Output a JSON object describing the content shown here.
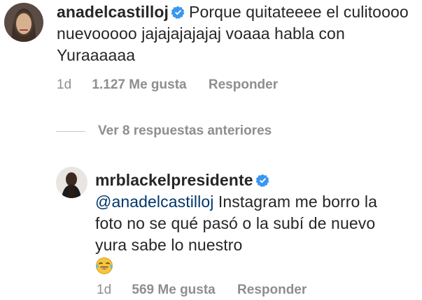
{
  "comment1": {
    "username": "anadelcastilloj",
    "text": "Porque quitateeee el culitoooo nuevooooo jajajajajajaj voaaa habla con Yuraaaaaa",
    "time": "1d",
    "likes": "1.127 Me gusta",
    "reply": "Responder"
  },
  "replies_toggle": "Ver 8 respuestas anteriores",
  "comment2": {
    "username": "mrblackelpresidente",
    "mention": "@anadelcastilloj",
    "text": " Instagram me borro la foto no se qué pasó o la subí de nuevo yura sabe lo nuestro",
    "emoji": "face-with-tears-of-joy-emoji",
    "time": "1d",
    "likes": "569 Me gusta",
    "reply": "Responder"
  },
  "colors": {
    "text": "#262626",
    "meta": "#8e8e8e",
    "mention": "#00376b",
    "verified": "#3897f0"
  }
}
